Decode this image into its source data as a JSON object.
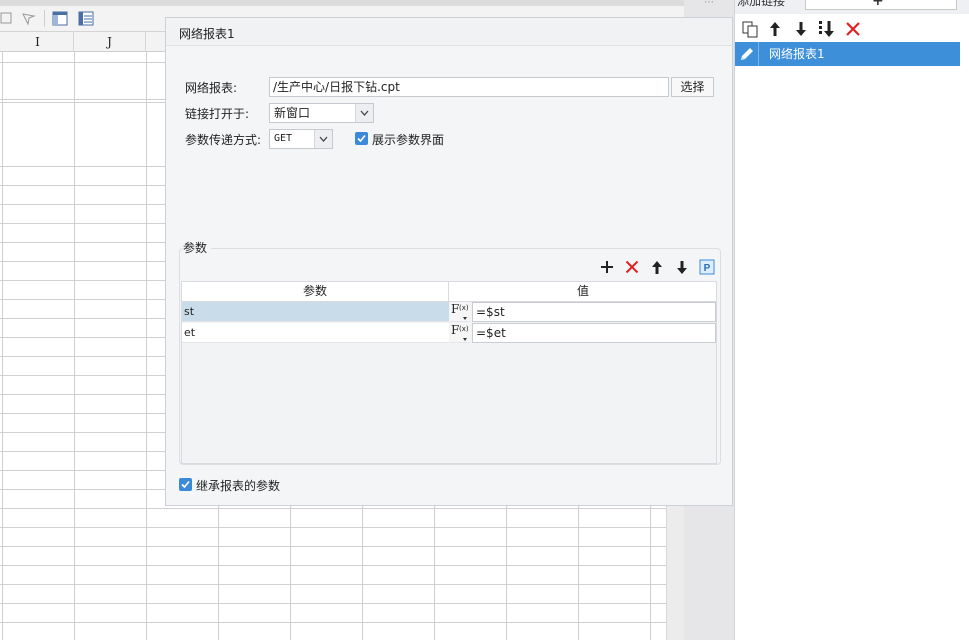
{
  "sheet": {
    "columns": [
      "I",
      "J"
    ]
  },
  "right_panel": {
    "title": "添加链接",
    "add_combo": "+",
    "links": [
      {
        "label": "网络报表1"
      }
    ]
  },
  "dialog": {
    "title": "网络报表1",
    "report_label": "网络报表:",
    "report_value": "/生产中心/日报下钻.cpt",
    "select_button": "选择",
    "open_in_label": "链接打开于:",
    "open_in_value": "新窗口",
    "method_label": "参数传递方式:",
    "method_value": "GET",
    "show_params_label": "展示参数界面",
    "show_params_checked": true,
    "params_group": "参数",
    "table": {
      "headers": [
        "参数",
        "值"
      ],
      "rows": [
        {
          "name": "st",
          "value": "=$st"
        },
        {
          "name": "et",
          "value": "=$et"
        }
      ]
    },
    "inherit_label": "继承报表的参数",
    "inherit_checked": true
  },
  "colors": {
    "selection_blue": "#3c8fd8",
    "checkbox_blue": "#3b8ad9",
    "delete_red": "#e02020",
    "row_selected": "#c9dcea"
  }
}
